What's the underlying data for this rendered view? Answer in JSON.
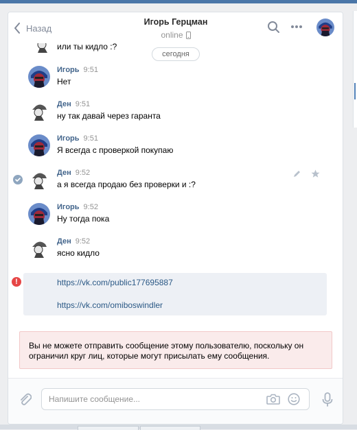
{
  "header": {
    "back_label": "Назад",
    "peer_name": "Игорь Герцман",
    "peer_status": "online"
  },
  "history": {
    "partial_message": "или ты кидло :?",
    "date_separator": "сегодня",
    "messages": [
      {
        "author": "Игорь",
        "time": "9:51",
        "text": "Нет",
        "avatar": "igor-avatar"
      },
      {
        "author": "Ден",
        "time": "9:51",
        "text": "ну так давай через гаранта",
        "avatar": "den-avatar"
      },
      {
        "author": "Игорь",
        "time": "9:51",
        "text": "Я всегда с проверкой покупаю",
        "avatar": "igor-avatar"
      },
      {
        "author": "Ден",
        "time": "9:52",
        "text": "а я всегда продаю без проверки и :?",
        "avatar": "den-avatar"
      },
      {
        "author": "Игорь",
        "time": "9:52",
        "text": "Ну тогда пока",
        "avatar": "igor-avatar"
      },
      {
        "author": "Ден",
        "time": "9:52",
        "text": "ясно кидло",
        "avatar": "den-avatar"
      }
    ],
    "failed_message": {
      "status_icon": "!",
      "links": [
        "https://vk.com/public177695887",
        "https://vk.com/omiboswindler"
      ]
    }
  },
  "notice": {
    "text": "Вы не можете отправить сообщение этому пользователю, поскольку он ограничил круг лиц, которые могут присылать ему сообщения."
  },
  "composer": {
    "placeholder": "Напишите сообщение...",
    "value": ""
  },
  "colors": {
    "accent": "#4a76a8",
    "link": "#2a5885",
    "author": "#42648b",
    "error": "#e64646",
    "notice_bg": "#faebeb"
  }
}
